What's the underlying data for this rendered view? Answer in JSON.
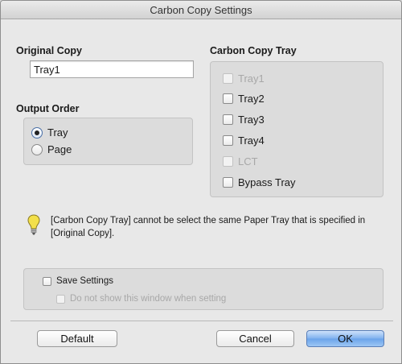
{
  "window": {
    "title": "Carbon Copy Settings"
  },
  "original_copy": {
    "label": "Original Copy",
    "value": "Tray1"
  },
  "output_order": {
    "label": "Output Order",
    "options": [
      {
        "label": "Tray",
        "selected": true
      },
      {
        "label": "Page",
        "selected": false
      }
    ]
  },
  "carbon_copy_tray": {
    "label": "Carbon Copy Tray",
    "items": [
      {
        "label": "Tray1",
        "checked": false,
        "enabled": false
      },
      {
        "label": "Tray2",
        "checked": false,
        "enabled": true
      },
      {
        "label": "Tray3",
        "checked": false,
        "enabled": true
      },
      {
        "label": "Tray4",
        "checked": false,
        "enabled": true
      },
      {
        "label": "LCT",
        "checked": false,
        "enabled": false
      },
      {
        "label": "Bypass Tray",
        "checked": false,
        "enabled": true
      }
    ]
  },
  "note": {
    "icon": "lightbulb-icon",
    "icon_color": "#f3e04a",
    "text": "[Carbon Copy Tray] cannot be select the same Paper Tray that is specified in [Original Copy]."
  },
  "save_settings": {
    "label": "Save Settings",
    "checked": false,
    "sub_option": {
      "label": "Do not show this window when setting",
      "checked": false,
      "enabled": false
    }
  },
  "buttons": {
    "default": "Default",
    "cancel": "Cancel",
    "ok": "OK"
  },
  "colors": {
    "accent": "#6aa3ea",
    "window_bg": "#e8e8e8",
    "group_bg": "#dcdcdc"
  }
}
